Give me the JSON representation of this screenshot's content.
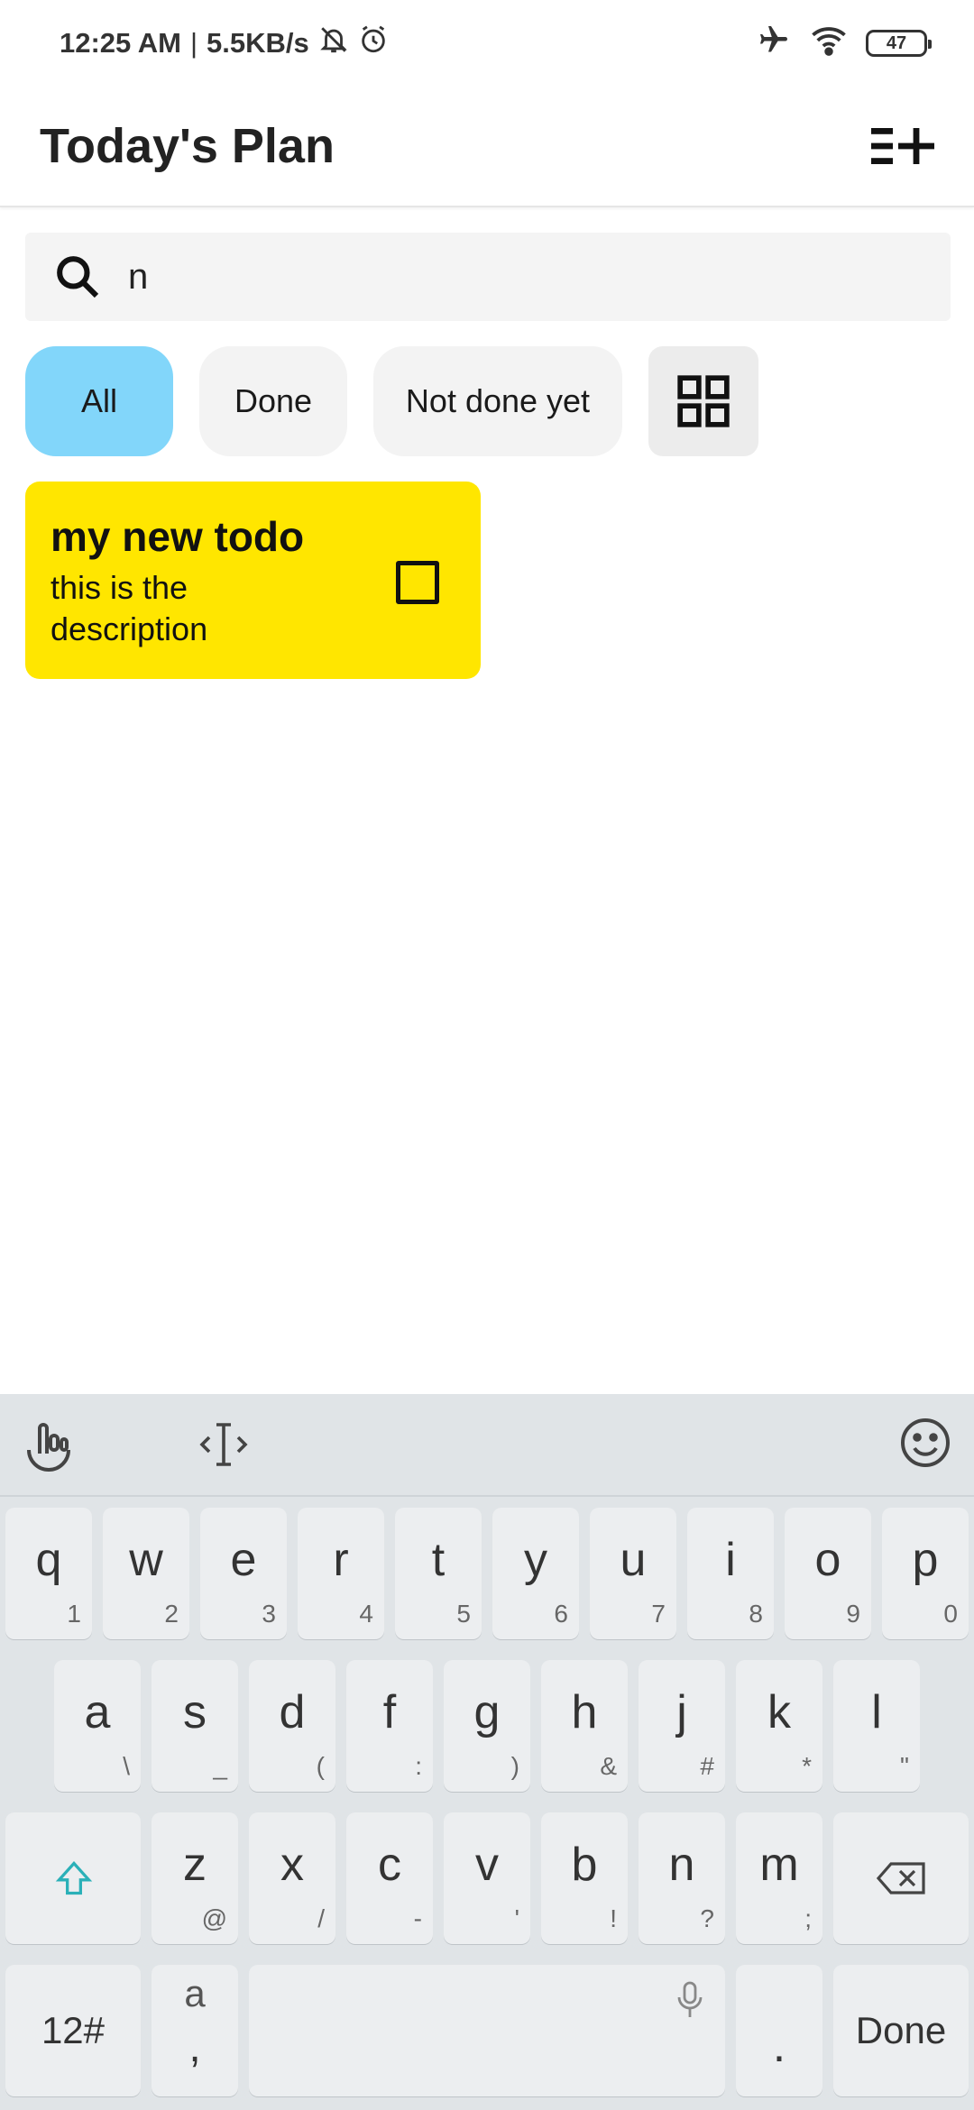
{
  "status_bar": {
    "time": "12:25 AM",
    "separator": "|",
    "speed": "5.5KB/s",
    "battery": "47"
  },
  "app_bar": {
    "title": "Today's Plan"
  },
  "search": {
    "value": "n"
  },
  "filters": {
    "all": "All",
    "done": "Done",
    "not_done": "Not done yet",
    "active": "All"
  },
  "todos": [
    {
      "title": "my new todo",
      "description": "this is the description",
      "done": false,
      "color": "#ffe600"
    }
  ],
  "keyboard": {
    "row1": [
      {
        "main": "q",
        "sub": "1"
      },
      {
        "main": "w",
        "sub": "2"
      },
      {
        "main": "e",
        "sub": "3"
      },
      {
        "main": "r",
        "sub": "4"
      },
      {
        "main": "t",
        "sub": "5"
      },
      {
        "main": "y",
        "sub": "6"
      },
      {
        "main": "u",
        "sub": "7"
      },
      {
        "main": "i",
        "sub": "8"
      },
      {
        "main": "o",
        "sub": "9"
      },
      {
        "main": "p",
        "sub": "0"
      }
    ],
    "row2": [
      {
        "main": "a",
        "sub": "\\"
      },
      {
        "main": "s",
        "sub": "_"
      },
      {
        "main": "d",
        "sub": "("
      },
      {
        "main": "f",
        "sub": ":"
      },
      {
        "main": "g",
        "sub": ")"
      },
      {
        "main": "h",
        "sub": "&"
      },
      {
        "main": "j",
        "sub": "#"
      },
      {
        "main": "k",
        "sub": "*"
      },
      {
        "main": "l",
        "sub": "\""
      }
    ],
    "row3": [
      {
        "main": "z",
        "sub": "@"
      },
      {
        "main": "x",
        "sub": "/"
      },
      {
        "main": "c",
        "sub": "-"
      },
      {
        "main": "v",
        "sub": "'"
      },
      {
        "main": "b",
        "sub": "!"
      },
      {
        "main": "n",
        "sub": "?"
      },
      {
        "main": "m",
        "sub": ";"
      }
    ],
    "symbols_label": "12#",
    "comma_top": "a",
    "comma_bottom": ",",
    "period": ".",
    "done_label": "Done"
  },
  "colors": {
    "accent_chip": "#82d6fa",
    "todo_card": "#ffe600",
    "shift_icon": "#2ab0b8"
  }
}
